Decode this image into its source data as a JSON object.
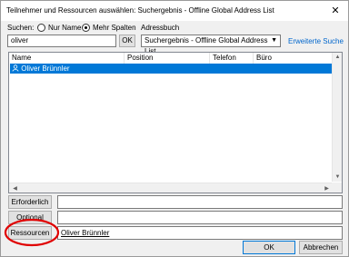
{
  "window": {
    "title": "Teilnehmer und Ressourcen auswählen: Suchergebnis - Offline Global Address List",
    "close_glyph": "✕"
  },
  "search": {
    "label": "Suchen:",
    "radio_name_only": "Nur Name",
    "radio_more_columns": "Mehr Spalten",
    "selected": "more_columns",
    "value": "oliver",
    "ok_button": "OK"
  },
  "addressbook": {
    "label": "Adressbuch",
    "selected": "Suchergebnis - Offline Global Address List",
    "advanced_search": "Erweiterte Suche"
  },
  "list": {
    "columns": [
      "Name",
      "Position",
      "Telefon geschäftlich",
      "Büro"
    ],
    "rows": [
      {
        "name": "Oliver Brünnler",
        "selected": true
      }
    ]
  },
  "recipients": {
    "required_button": "Erforderlich",
    "required_value": "",
    "optional_button": "Optional",
    "optional_value": "",
    "resources_button": "Ressourcen",
    "resources_value": "Oliver Brünnler"
  },
  "footer": {
    "ok": "OK",
    "cancel": "Abbrechen"
  },
  "colors": {
    "selection": "#0078d7",
    "link": "#0066cc",
    "highlight_circle": "#e00000"
  }
}
